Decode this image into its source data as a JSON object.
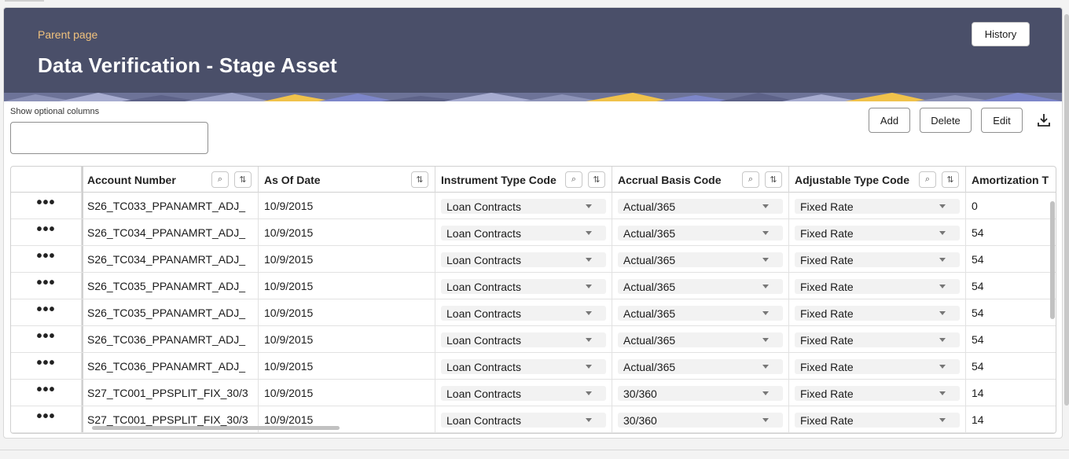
{
  "header": {
    "parent_link": "Parent page",
    "title": "Data Verification - Stage Asset",
    "history_label": "History"
  },
  "toolbar": {
    "optional_columns_label": "Show optional columns",
    "optional_columns_value": "",
    "add_label": "Add",
    "delete_label": "Delete",
    "edit_label": "Edit",
    "download_icon": "download-icon"
  },
  "table": {
    "columns": [
      {
        "label": "Account Number"
      },
      {
        "label": "As Of Date"
      },
      {
        "label": "Instrument Type Code"
      },
      {
        "label": "Accrual Basis Code"
      },
      {
        "label": "Adjustable Type Code"
      },
      {
        "label": "Amortization T"
      }
    ],
    "rows": [
      {
        "menu": "•••",
        "account": "S26_TC033_PPANAMRT_ADJ_",
        "date": "10/9/2015",
        "instrument": "Loan Contracts",
        "accrual": "Actual/365",
        "adjustable": "Fixed Rate",
        "amort": "0"
      },
      {
        "menu": "•••",
        "account": "S26_TC034_PPANAMRT_ADJ_",
        "date": "10/9/2015",
        "instrument": "Loan Contracts",
        "accrual": "Actual/365",
        "adjustable": "Fixed Rate",
        "amort": "54"
      },
      {
        "menu": "•••",
        "account": "S26_TC034_PPANAMRT_ADJ_",
        "date": "10/9/2015",
        "instrument": "Loan Contracts",
        "accrual": "Actual/365",
        "adjustable": "Fixed Rate",
        "amort": "54"
      },
      {
        "menu": "•••",
        "account": "S26_TC035_PPANAMRT_ADJ_",
        "date": "10/9/2015",
        "instrument": "Loan Contracts",
        "accrual": "Actual/365",
        "adjustable": "Fixed Rate",
        "amort": "54"
      },
      {
        "menu": "•••",
        "account": "S26_TC035_PPANAMRT_ADJ_",
        "date": "10/9/2015",
        "instrument": "Loan Contracts",
        "accrual": "Actual/365",
        "adjustable": "Fixed Rate",
        "amort": "54"
      },
      {
        "menu": "•••",
        "account": "S26_TC036_PPANAMRT_ADJ_",
        "date": "10/9/2015",
        "instrument": "Loan Contracts",
        "accrual": "Actual/365",
        "adjustable": "Fixed Rate",
        "amort": "54"
      },
      {
        "menu": "•••",
        "account": "S26_TC036_PPANAMRT_ADJ_",
        "date": "10/9/2015",
        "instrument": "Loan Contracts",
        "accrual": "Actual/365",
        "adjustable": "Fixed Rate",
        "amort": "54"
      },
      {
        "menu": "•••",
        "account": "S27_TC001_PPSPLIT_FIX_30/3",
        "date": "10/9/2015",
        "instrument": "Loan Contracts",
        "accrual": "30/360",
        "adjustable": "Fixed Rate",
        "amort": "14"
      },
      {
        "menu": "•••",
        "account": "S27_TC001_PPSPLIT_FIX_30/3",
        "date": "10/9/2015",
        "instrument": "Loan Contracts",
        "accrual": "30/360",
        "adjustable": "Fixed Rate",
        "amort": "14"
      }
    ]
  },
  "colors": {
    "header_bg": "#4a4f69",
    "parent_link": "#f1c27d",
    "band_yellow": "#f0c24b",
    "band_blue": "#7d86c9"
  }
}
